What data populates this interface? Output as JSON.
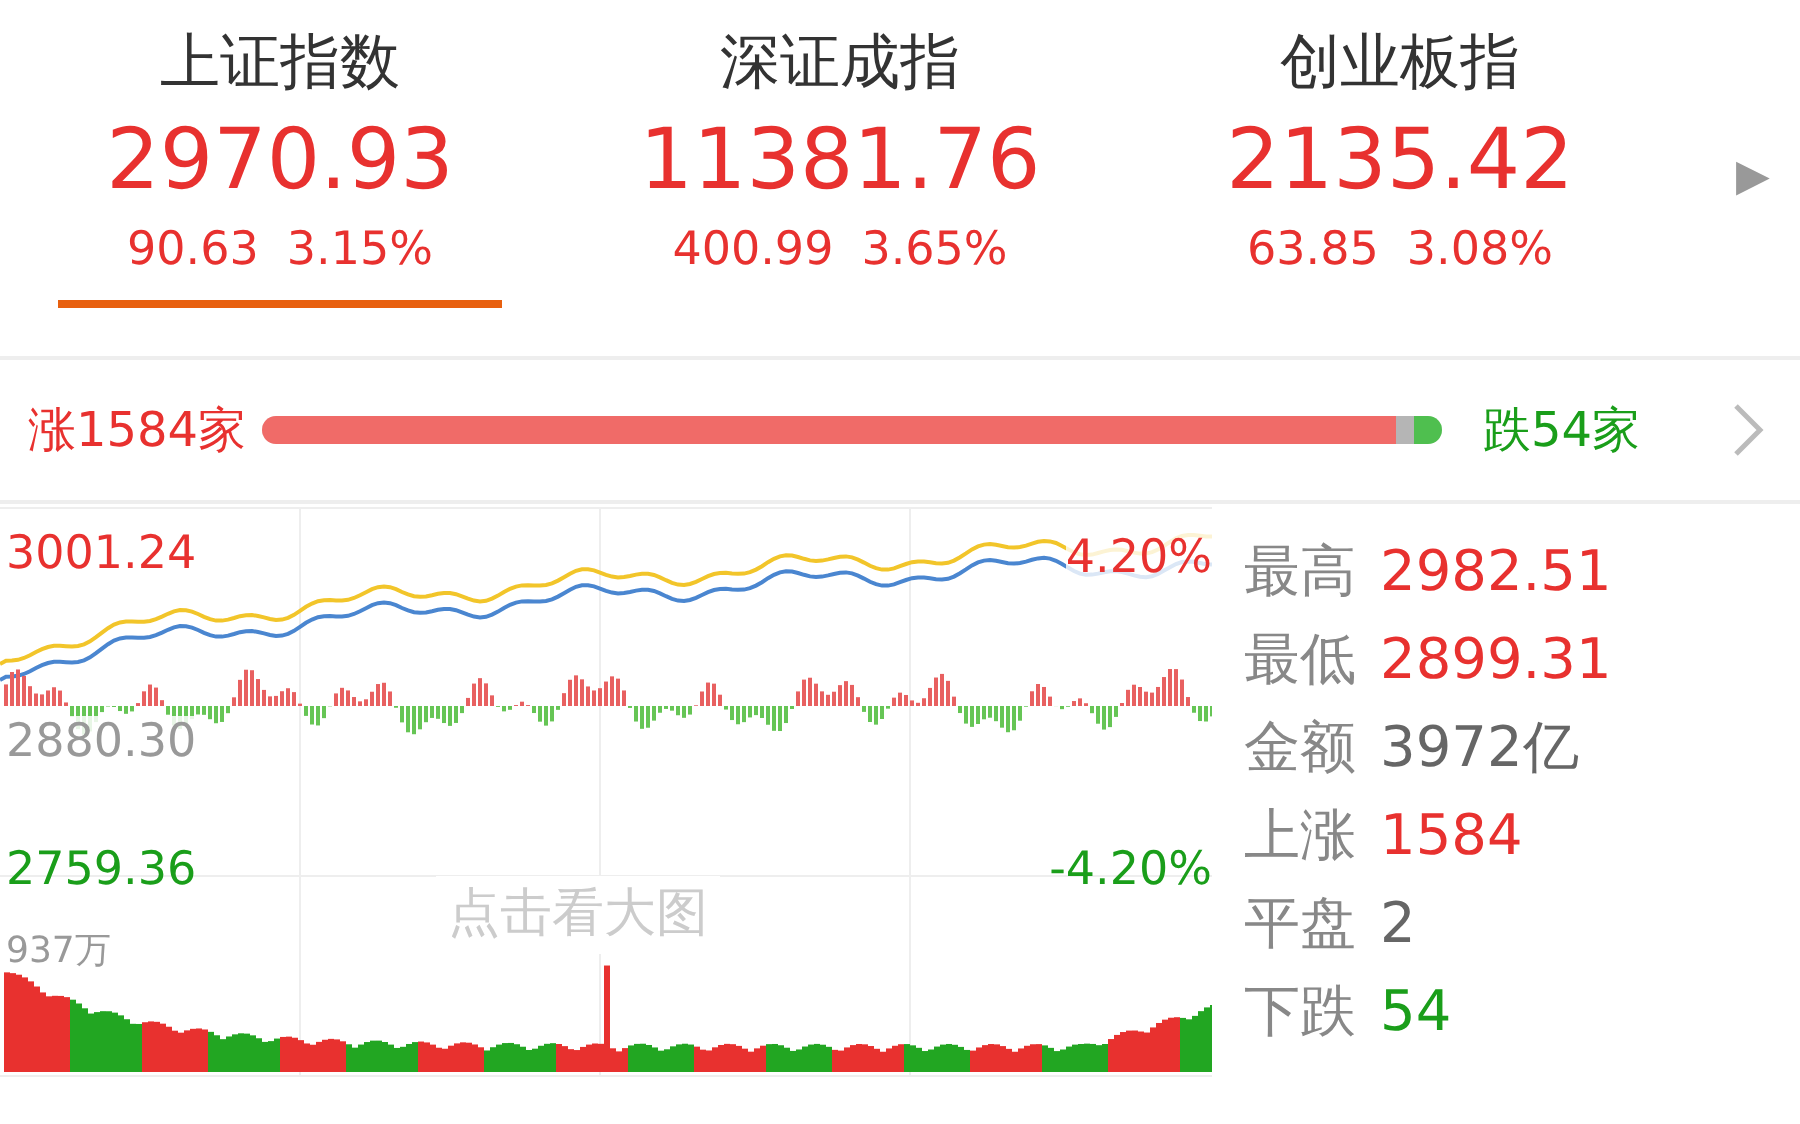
{
  "indices": [
    {
      "name": "上证指数",
      "value": "2970.93",
      "change": "90.63",
      "percent": "3.15%",
      "color": "#e8312f",
      "selected": true
    },
    {
      "name": "深证成指",
      "value": "11381.76",
      "change": "400.99",
      "percent": "3.65%",
      "color": "#e8312f",
      "selected": false
    },
    {
      "name": "创业板指",
      "value": "2135.42",
      "change": "63.85",
      "percent": "3.08%",
      "color": "#e8312f",
      "selected": false
    }
  ],
  "more_arrow": "▶",
  "breadth": {
    "up_label": "涨1584家",
    "down_label": "跌54家",
    "segments": [
      {
        "level": 0.96,
        "color": "#f06b68"
      },
      {
        "color": "#b5b5b5"
      },
      {
        "level": 0.025,
        "color": "#4fbf4f"
      }
    ]
  },
  "chart": {
    "high_price": "3001.24",
    "high_pct": "4.20%",
    "mid_price": "2880.30",
    "low_price": "2759.36",
    "low_pct": "-4.20%",
    "volume_max": "937万",
    "overlay": "点击看大图"
  },
  "stats": [
    {
      "label": "最高",
      "value": "2982.51",
      "color": "#e8312f"
    },
    {
      "label": "最低",
      "value": "2899.31",
      "color": "#e8312f"
    },
    {
      "label": "金额",
      "value": "3972亿",
      "color": "#666666"
    },
    {
      "label": "上涨",
      "value": "1584",
      "color": "#e8312f"
    },
    {
      "label": "平盘",
      "value": "2",
      "color": "#666666"
    },
    {
      "label": "下跌",
      "value": "54",
      "color": "#1a9e1a"
    }
  ]
}
